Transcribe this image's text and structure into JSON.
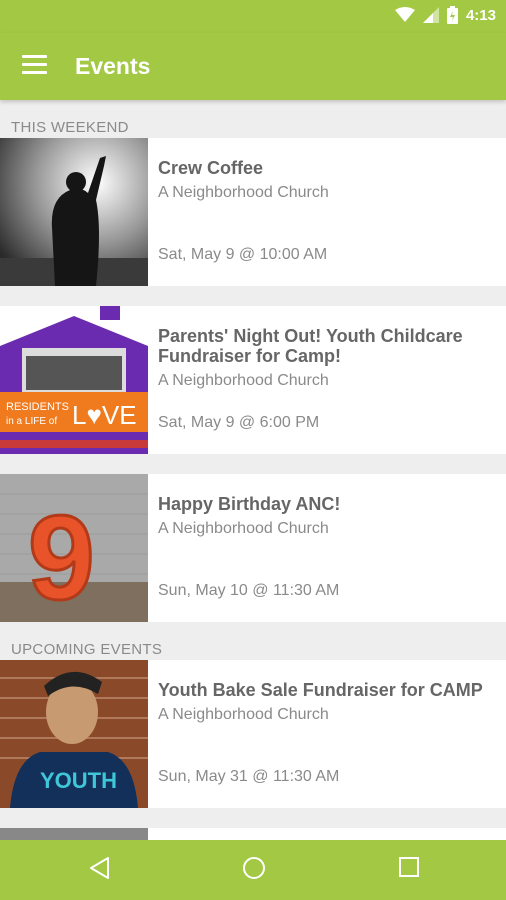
{
  "status_bar": {
    "time": "4:13"
  },
  "app_bar": {
    "title": "Events"
  },
  "sections": {
    "this_weekend": {
      "label": "THIS WEEKEND",
      "events": [
        {
          "title": "Crew Coffee",
          "org": "A Neighborhood Church",
          "date": "Sat, May 9 @ 10:00 AM"
        },
        {
          "title": "Parents' Night Out! Youth Childcare Fundraiser for Camp!",
          "org": "A Neighborhood Church",
          "date": "Sat, May 9 @ 6:00 PM"
        },
        {
          "title": "Happy Birthday ANC!",
          "org": "A Neighborhood Church",
          "date": "Sun, May 10 @ 11:30 AM"
        }
      ]
    },
    "upcoming": {
      "label": "UPCOMING EVENTS",
      "events": [
        {
          "title": "Youth Bake Sale Fundraiser for CAMP",
          "org": "A Neighborhood Church",
          "date": "Sun, May 31 @ 11:30 AM"
        }
      ]
    }
  },
  "thumbnails": {
    "love_banner_line1": "RESIDENTS",
    "love_banner_line2": "in a LIFE of",
    "love_word": "L♥VE",
    "number_nine": "9",
    "shirt_text": "YOUTH"
  },
  "colors": {
    "accent": "#a2c844",
    "text_primary": "#666666",
    "text_secondary": "#8a8a8a"
  }
}
